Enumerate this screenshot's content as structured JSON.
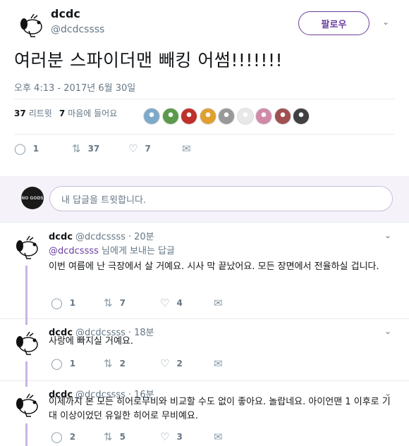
{
  "main_tweet": {
    "name": "dcdc",
    "handle": "@dcdcssss",
    "follow_label": "팔로우",
    "text": "여러분 스파이더맨 빼킹 어썸!!!!!!!",
    "timestamp": "오후 4:13 - 2017년 6월 30일",
    "retweets_count": "37",
    "retweets_label": "리트윗",
    "likes_count": "7",
    "likes_label": "마음에 들어요",
    "actions": {
      "reply": "1",
      "retweet": "37",
      "like": "7"
    },
    "liker_colors": [
      "#7fa9c9",
      "#5a9a4a",
      "#c0302a",
      "#e0a030",
      "#999999",
      "#e8e8e8",
      "#d08aa8",
      "#a05050",
      "#404040"
    ]
  },
  "reply_box": {
    "avatar_text": "NO GODS",
    "placeholder": "내 답글을 트윗합니다."
  },
  "replies": [
    {
      "name": "dcdc",
      "handle": "@dcdcssss",
      "time": "20분",
      "to_mention": "@dcdcssss",
      "to_suffix": "님에게 보내는 답글",
      "text": "이번 여름에 난 극장에서 살 거예요. 시사 막 끝났어요. 모든 장면에서 전율하실 겁니다.",
      "reply": "1",
      "retweet": "7",
      "like": "4"
    },
    {
      "name": "dcdc",
      "handle": "@dcdcssss",
      "time": "18분",
      "text": "사랑에 빠지실 거예요.",
      "reply": "1",
      "retweet": "2",
      "like": "2"
    },
    {
      "name": "dcdc",
      "handle": "@dcdcssss",
      "time": "16분",
      "text": "이제까지 본 모든 히어로무비와 비교할 수도 없이 좋아요. 놀랍네요. 아이언맨 1 이후로 기대 이상이었던 유일한 히어로 무비예요.",
      "reply": "2",
      "retweet": "5",
      "like": "3"
    }
  ],
  "icons": {
    "reply": "reply-icon",
    "retweet": "retweet-icon",
    "like": "heart-icon",
    "dm": "envelope-icon",
    "caret": "chevron-down-icon"
  },
  "colors": {
    "accent": "#6a3e9e",
    "thread": "#c9b3e6",
    "muted": "#657786"
  }
}
